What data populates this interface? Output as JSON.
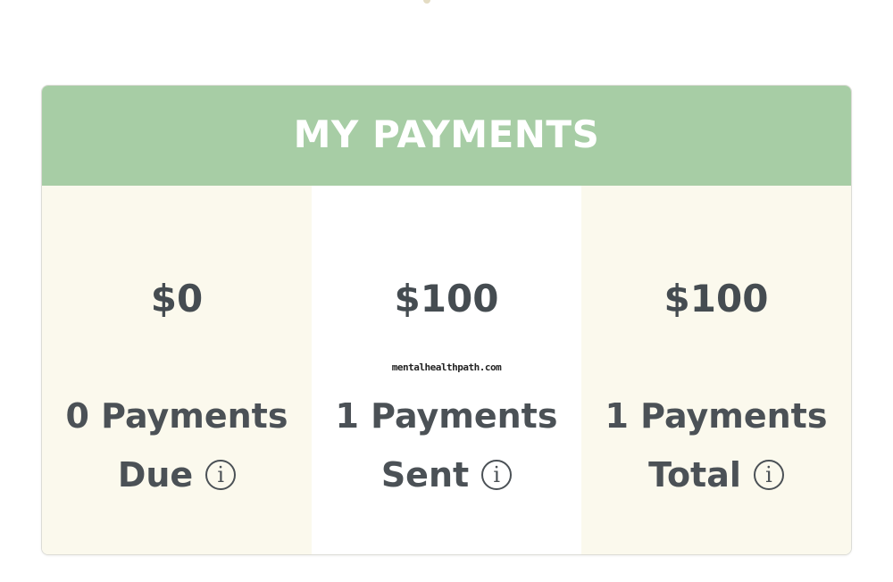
{
  "card": {
    "title": "MY PAYMENTS"
  },
  "columns": [
    {
      "amount": "$0",
      "count": "0 Payments",
      "label": "Due",
      "icon": "info-icon"
    },
    {
      "amount": "$100",
      "count": "1 Payments",
      "label": "Sent",
      "icon": "info-icon"
    },
    {
      "amount": "$100",
      "count": "1 Payments",
      "label": "Total",
      "icon": "info-icon"
    }
  ],
  "watermark": "mentalhealthpath.com",
  "colors": {
    "header": "#a7cda5",
    "tinted_column": "#fbf9ed",
    "text": "#4b5156"
  },
  "icon_glyph": "i"
}
